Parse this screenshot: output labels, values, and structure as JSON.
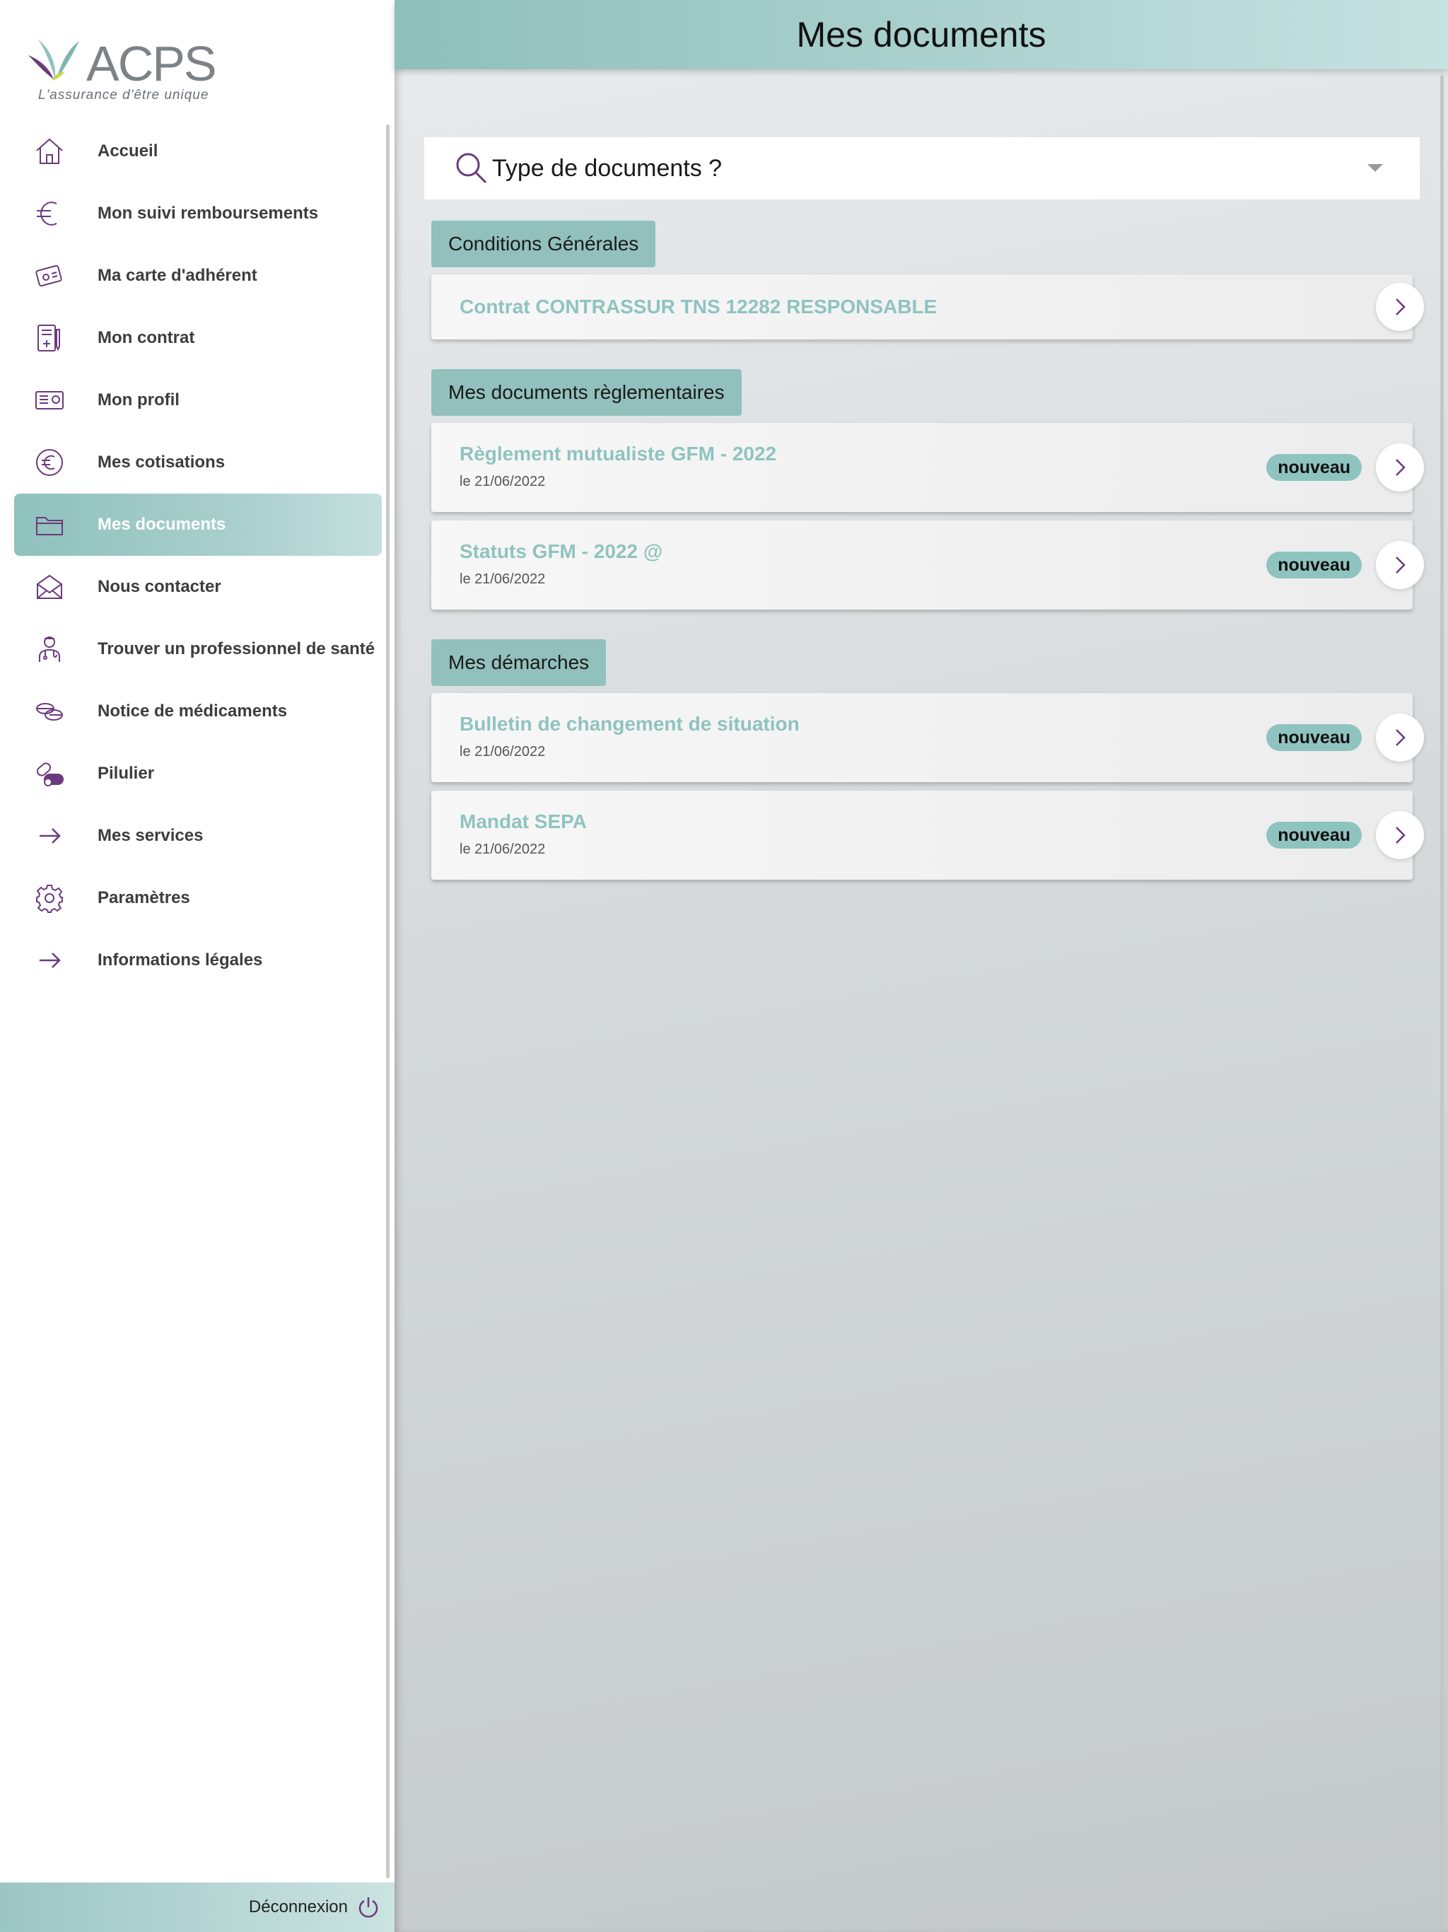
{
  "brand": {
    "name": "ACPS",
    "tagline": "L'assurance d'être unique"
  },
  "sidebar": {
    "items": [
      {
        "label": "Accueil",
        "icon": "home-icon"
      },
      {
        "label": "Mon suivi remboursements",
        "icon": "euro-icon"
      },
      {
        "label": "Ma carte d'adhérent",
        "icon": "card-icon"
      },
      {
        "label": "Mon contrat",
        "icon": "contract-icon"
      },
      {
        "label": "Mon profil",
        "icon": "profile-card-icon"
      },
      {
        "label": "Mes cotisations",
        "icon": "euro-circle-icon"
      },
      {
        "label": "Mes documents",
        "icon": "folder-icon",
        "active": true
      },
      {
        "label": "Nous contacter",
        "icon": "envelope-icon"
      },
      {
        "label": "Trouver un professionnel de santé",
        "icon": "doctor-icon"
      },
      {
        "label": "Notice de médicaments",
        "icon": "pills-icon"
      },
      {
        "label": "Pilulier",
        "icon": "pill-box-icon"
      },
      {
        "label": "Mes services",
        "icon": "arrow-right-icon"
      },
      {
        "label": "Paramètres",
        "icon": "gear-icon"
      },
      {
        "label": "Informations légales",
        "icon": "arrow-right-icon"
      }
    ],
    "logout_label": "Déconnexion"
  },
  "header": {
    "title": "Mes documents"
  },
  "search": {
    "placeholder": "Type de documents ?"
  },
  "sections": [
    {
      "title": "Conditions Générales",
      "documents": [
        {
          "title": "Contrat CONTRASSUR TNS 12282 RESPONSABLE"
        }
      ]
    },
    {
      "title": "Mes documents règlementaires",
      "documents": [
        {
          "title": "Règlement mutualiste GFM - 2022",
          "date": "le 21/06/2022",
          "badge": "nouveau"
        },
        {
          "title": "Statuts GFM - 2022 @",
          "date": "le 21/06/2022",
          "badge": "nouveau"
        }
      ]
    },
    {
      "title": "Mes démarches",
      "documents": [
        {
          "title": "Bulletin de changement de situation",
          "date": "le 21/06/2022",
          "badge": "nouveau"
        },
        {
          "title": "Mandat SEPA",
          "date": "le 21/06/2022",
          "badge": "nouveau"
        }
      ]
    }
  ],
  "colors": {
    "accent": "#8fc3bf",
    "icon": "#6b3a7d",
    "header_start": "#8fbfbb",
    "header_end": "#c6e2e1"
  }
}
